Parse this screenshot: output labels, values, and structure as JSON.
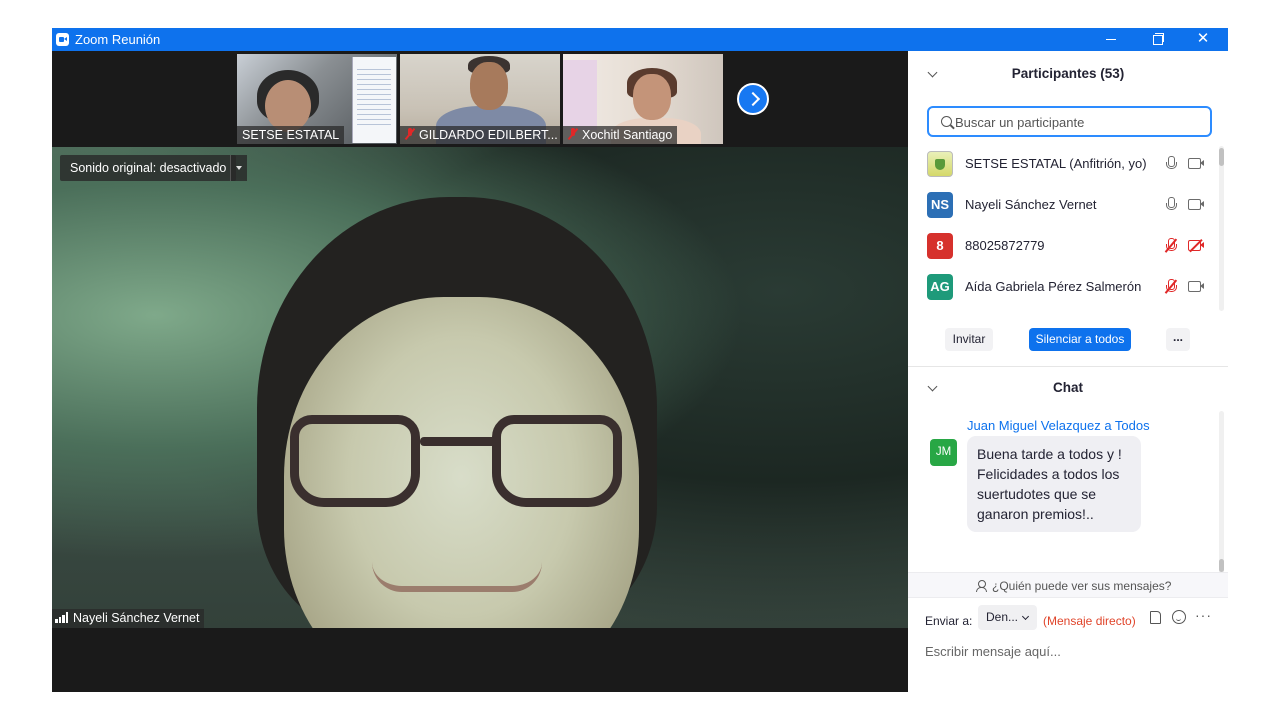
{
  "window": {
    "title": "Zoom Reunión"
  },
  "thumbnails": [
    {
      "name": "SETSE ESTATAL",
      "muted": false
    },
    {
      "name": "GILDARDO EDILBERT...",
      "muted": true
    },
    {
      "name": "Xochitl Santiago",
      "muted": true
    }
  ],
  "main_video": {
    "sound_chip": "Sonido original: desactivado",
    "speaker": "Nayeli Sánchez Vernet"
  },
  "participants": {
    "title": "Participantes (53)",
    "search_placeholder": "Buscar un participante",
    "items": [
      {
        "avatar": "",
        "avatar_color": "#d5d96a",
        "name": "SETSE ESTATAL (Anfitrión, yo)",
        "mic": "on",
        "cam": "on"
      },
      {
        "avatar": "NS",
        "avatar_color": "#2c6fb5",
        "name": "Nayeli Sánchez Vernet",
        "mic": "on",
        "cam": "on"
      },
      {
        "avatar": "8",
        "avatar_color": "#d6312c",
        "name": "88025872779",
        "mic": "off",
        "cam": "off"
      },
      {
        "avatar": "AG",
        "avatar_color": "#1e9a7a",
        "name": "Aída Gabriela Pérez Salmerón",
        "mic": "off",
        "cam": "on"
      }
    ],
    "invite_label": "Invitar",
    "mute_all_label": "Silenciar a todos",
    "more_label": "..."
  },
  "chat": {
    "title": "Chat",
    "messages": [
      {
        "sender": "Juan Miguel Velazquez a Todos",
        "avatar": "JM",
        "avatar_color": "#28a745",
        "text": "Buena tarde a todos y ! Felicidades a todos los suertudotes que se ganaron premios!.."
      }
    ],
    "privacy_text": "¿Quién puede ver sus mensajes?",
    "send_to_label": "Enviar a:",
    "recipient": "Den...",
    "direct_label": "(Mensaje directo)",
    "more_icon": "···",
    "input_placeholder": "Escribir mensaje aquí..."
  },
  "colors": {
    "titlebar": "#0e72ed",
    "accent": "#2d8cff",
    "mute_red": "#e02828"
  }
}
